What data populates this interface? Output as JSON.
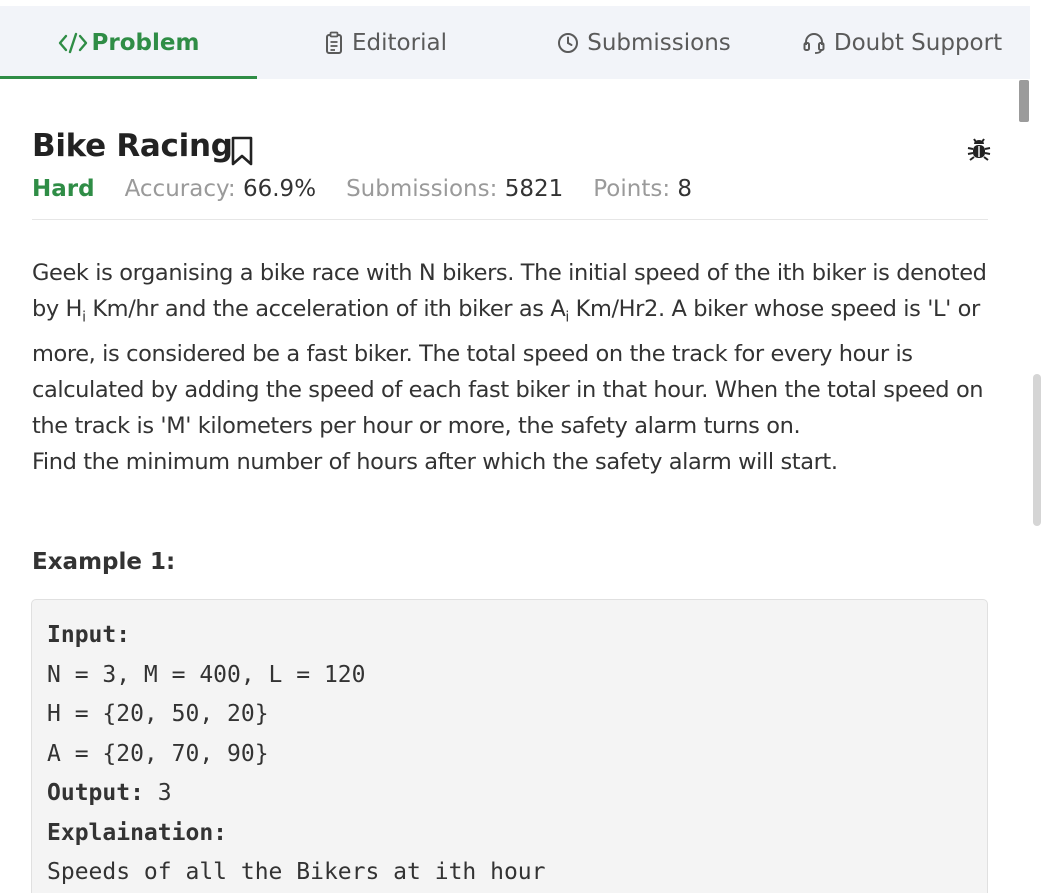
{
  "tabs": {
    "problem": "Problem",
    "editorial": "Editorial",
    "submissions": "Submissions",
    "doubt_support": "Doubt Support"
  },
  "problem": {
    "title": "Bike Racing",
    "difficulty": "Hard",
    "accuracy_label": "Accuracy:",
    "accuracy_value": "66.9%",
    "submissions_label": "Submissions:",
    "submissions_value": "5821",
    "points_label": "Points:",
    "points_value": "8"
  },
  "description": {
    "p1_a": "Geek is organising a bike race with N bikers. The initial speed of the ith biker is denoted by H",
    "p1_sub_i": "i",
    "p1_b": " Km/hr and the acceleration of ith biker as A",
    "p1_sub_i2": "i",
    "p1_c": " Km/Hr2. A biker whose speed is 'L' or more, is considered be a fast biker. The total speed on the track for every hour is calculated by adding the speed of each fast biker in that hour. When the total speed on the track is 'M' kilometers per hour or more, the safety alarm turns on.",
    "p2": "Find the minimum number of hours after which the safety alarm will start."
  },
  "example": {
    "heading": "Example 1:",
    "input_label": "Input:",
    "line1": "N = 3, M = 400, L = 120",
    "line2": "H = {20, 50, 20}",
    "line3": "A = {20, 70, 90}",
    "output_label": "Output:",
    "output_value": " 3",
    "explanation_label": "Explaination:",
    "line4": "Speeds of all the Bikers at ith hour"
  },
  "colors": {
    "accent": "#2f8d46",
    "tab_bg": "#f2f4f9",
    "code_bg": "#f4f4f4"
  },
  "icons": {
    "problem": "code-icon",
    "editorial": "document-icon",
    "submissions": "clock-icon",
    "doubt_support": "headset-icon",
    "bookmark": "bookmark-icon",
    "report": "bug-icon"
  }
}
